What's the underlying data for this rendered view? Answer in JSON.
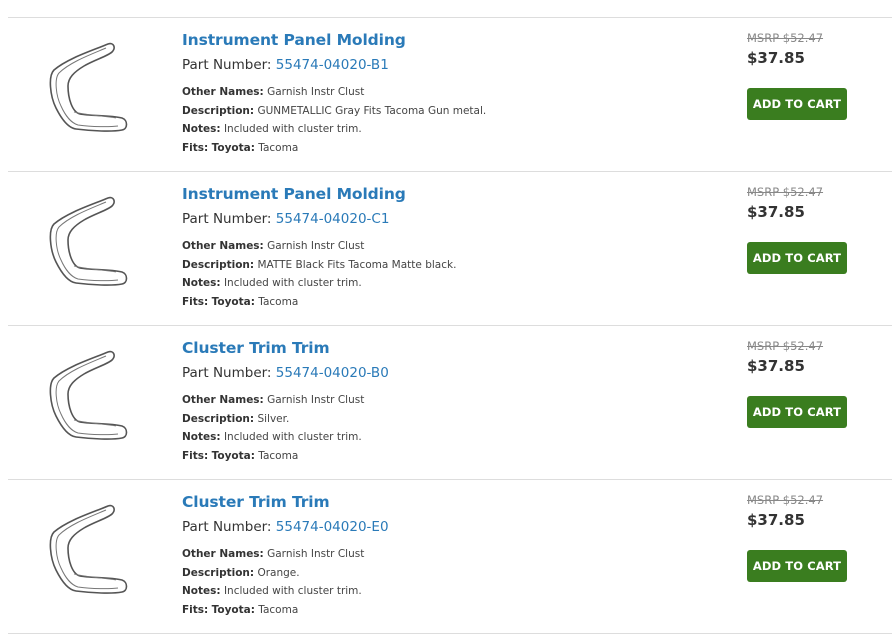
{
  "currency_note": "",
  "colors": {
    "link": "#2a7ab8",
    "cart_button": "#3a7d1f",
    "divider": "#dddddd"
  },
  "labels": {
    "part_number": "Part Number:",
    "other_names": "Other Names:",
    "description": "Description:",
    "notes": "Notes:",
    "fits": "Fits:",
    "add_to_cart": "ADD TO CART"
  },
  "products": [
    {
      "title": "Instrument Panel Molding",
      "part_number": "55474-04020-B1",
      "other_names": "Garnish Instr Clust",
      "description": "GUNMETALLIC Gray Fits Tacoma Gun metal.",
      "notes": "Included with cluster trim.",
      "fits_make": "Toyota:",
      "fits_model": "Tacoma",
      "msrp": "MSRP $52.47",
      "price": "$37.85",
      "image_icon": "dashboard-trim-part-image"
    },
    {
      "title": "Instrument Panel Molding",
      "part_number": "55474-04020-C1",
      "other_names": "Garnish Instr Clust",
      "description": "MATTE Black Fits Tacoma Matte black.",
      "notes": "Included with cluster trim.",
      "fits_make": "Toyota:",
      "fits_model": "Tacoma",
      "msrp": "MSRP $52.47",
      "price": "$37.85",
      "image_icon": "dashboard-trim-part-image"
    },
    {
      "title": "Cluster Trim Trim",
      "part_number": "55474-04020-B0",
      "other_names": "Garnish Instr Clust",
      "description": "Silver.",
      "notes": "Included with cluster trim.",
      "fits_make": "Toyota:",
      "fits_model": "Tacoma",
      "msrp": "MSRP $52.47",
      "price": "$37.85",
      "image_icon": "dashboard-trim-part-image"
    },
    {
      "title": "Cluster Trim Trim",
      "part_number": "55474-04020-E0",
      "other_names": "Garnish Instr Clust",
      "description": "Orange.",
      "notes": "Included with cluster trim.",
      "fits_make": "Toyota:",
      "fits_model": "Tacoma",
      "msrp": "MSRP $52.47",
      "price": "$37.85",
      "image_icon": "dashboard-trim-part-image"
    }
  ]
}
